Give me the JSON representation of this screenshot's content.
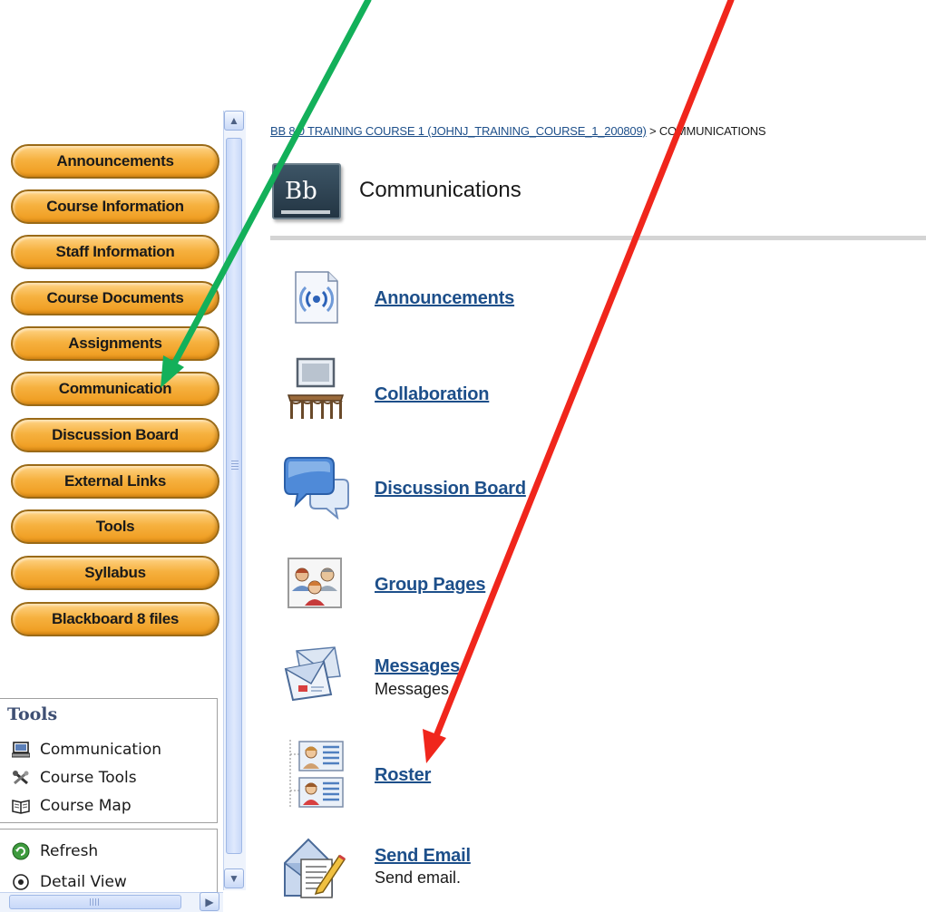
{
  "left_menu": {
    "items": [
      {
        "label": "Announcements"
      },
      {
        "label": "Course Information"
      },
      {
        "label": "Staff Information"
      },
      {
        "label": "Course Documents"
      },
      {
        "label": "Assignments"
      },
      {
        "label": "Communication"
      },
      {
        "label": "Discussion Board"
      },
      {
        "label": "External Links"
      },
      {
        "label": "Tools"
      },
      {
        "label": "Syllabus"
      },
      {
        "label": "Blackboard 8 files"
      }
    ],
    "button_color": "#f6b13f"
  },
  "tools_panel": {
    "heading": "Tools",
    "items": [
      {
        "label": "Communication",
        "icon": "computer-icon"
      },
      {
        "label": "Course Tools",
        "icon": "tools-icon"
      },
      {
        "label": "Course Map",
        "icon": "book-icon"
      }
    ]
  },
  "view_panel": {
    "items": [
      {
        "label": "Refresh",
        "icon": "refresh-icon"
      },
      {
        "label": "Detail View",
        "icon": "detail-view-icon"
      }
    ]
  },
  "breadcrumb": {
    "course_link": "BB 8.0 TRAINING COURSE 1 (JOHNJ_TRAINING_COURSE_1_200809)",
    "separator": " > ",
    "current": "COMMUNICATIONS"
  },
  "header": {
    "logo_text": "Bb",
    "title": "Communications"
  },
  "communication_tools": [
    {
      "label": "Announcements",
      "icon": "announcements-icon",
      "description": ""
    },
    {
      "label": "Collaboration",
      "icon": "collaboration-icon",
      "description": ""
    },
    {
      "label": "Discussion Board",
      "icon": "discussion-board-icon",
      "description": ""
    },
    {
      "label": "Group Pages",
      "icon": "group-pages-icon",
      "description": ""
    },
    {
      "label": "Messages",
      "icon": "messages-icon",
      "description": "Messages"
    },
    {
      "label": "Roster",
      "icon": "roster-icon",
      "description": ""
    },
    {
      "label": "Send Email",
      "icon": "send-email-icon",
      "description": "Send email."
    }
  ],
  "annotations": {
    "green_arrow_color": "#13b05a",
    "red_arrow_color": "#f0261c"
  },
  "colors": {
    "link": "#1d4f8a",
    "scrollbar": "#eef3fc"
  }
}
